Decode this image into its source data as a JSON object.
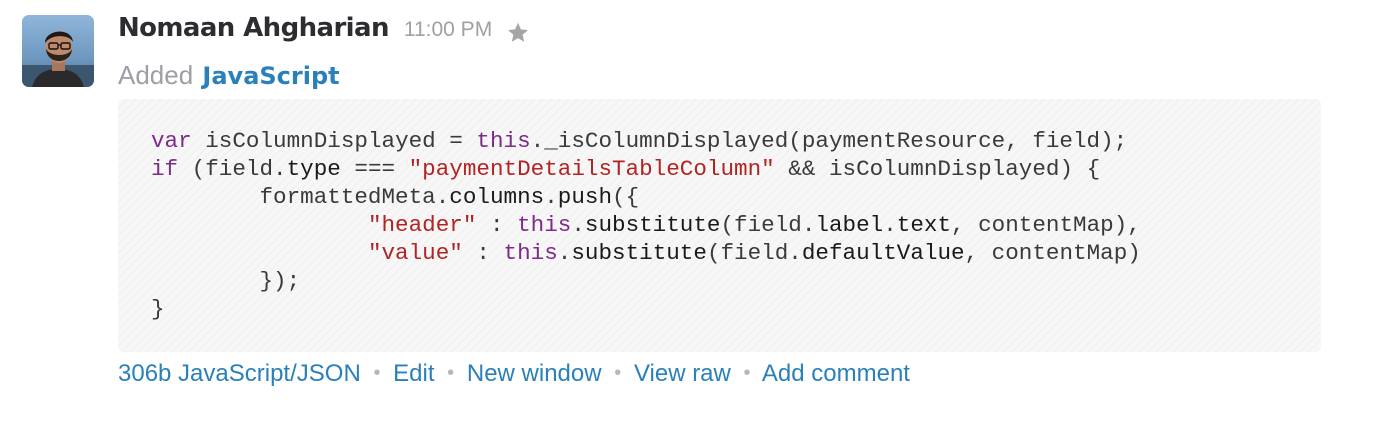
{
  "message": {
    "author": "Nomaan Ahgharian",
    "timestamp": "11:00 PM",
    "action_text": "Added",
    "language_link": "JavaScript",
    "star_icon": "star-icon",
    "colors": {
      "author": "#2c2d30",
      "link": "#2a80b9",
      "muted": "#a0a0a2",
      "keyword": "#7d2a8a",
      "string": "#b22323"
    }
  },
  "snippet": {
    "lines": [
      [
        {
          "t": "var",
          "c": "kw"
        },
        {
          "t": " isColumnDisplayed = ",
          "c": "plain"
        },
        {
          "t": "this",
          "c": "kw"
        },
        {
          "t": "._isColumnDisplayed(paymentResource, field);",
          "c": "plain"
        }
      ],
      [
        {
          "t": "if",
          "c": "kw"
        },
        {
          "t": " (field.",
          "c": "plain"
        },
        {
          "t": "type",
          "c": "prop"
        },
        {
          "t": " === ",
          "c": "plain"
        },
        {
          "t": "\"paymentDetailsTableColumn\"",
          "c": "str"
        },
        {
          "t": " && isColumnDisplayed) {",
          "c": "plain"
        }
      ],
      [
        {
          "t": "        formattedMeta.",
          "c": "plain"
        },
        {
          "t": "columns",
          "c": "prop"
        },
        {
          "t": ".",
          "c": "plain"
        },
        {
          "t": "push",
          "c": "prop"
        },
        {
          "t": "({",
          "c": "plain"
        }
      ],
      [
        {
          "t": "                ",
          "c": "plain"
        },
        {
          "t": "\"header\"",
          "c": "str"
        },
        {
          "t": " : ",
          "c": "plain"
        },
        {
          "t": "this",
          "c": "kw"
        },
        {
          "t": ".",
          "c": "plain"
        },
        {
          "t": "substitute",
          "c": "prop"
        },
        {
          "t": "(field.",
          "c": "plain"
        },
        {
          "t": "label",
          "c": "prop"
        },
        {
          "t": ".",
          "c": "plain"
        },
        {
          "t": "text",
          "c": "prop"
        },
        {
          "t": ", contentMap),",
          "c": "plain"
        }
      ],
      [
        {
          "t": "                ",
          "c": "plain"
        },
        {
          "t": "\"value\"",
          "c": "str"
        },
        {
          "t": " : ",
          "c": "plain"
        },
        {
          "t": "this",
          "c": "kw"
        },
        {
          "t": ".",
          "c": "plain"
        },
        {
          "t": "substitute",
          "c": "prop"
        },
        {
          "t": "(field.",
          "c": "plain"
        },
        {
          "t": "defaultValue",
          "c": "prop"
        },
        {
          "t": ", contentMap)",
          "c": "plain"
        }
      ],
      [
        {
          "t": "        });",
          "c": "plain"
        }
      ],
      [
        {
          "t": "}",
          "c": "plain"
        }
      ]
    ]
  },
  "footer": {
    "size_type": "306b JavaScript/JSON",
    "separator": "•",
    "edit": "Edit",
    "new_window": "New window",
    "view_raw": "View raw",
    "add_comment": "Add comment"
  }
}
